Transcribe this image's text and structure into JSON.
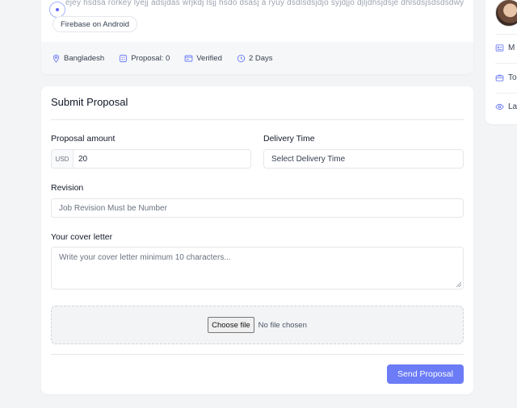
{
  "job": {
    "description_partial": "ejey hsdsa rorkey lyejj adsjdas wrjkdj lsjj hsdo dsasj a ryuy dsdlsdsjdjo syjdjjo djljdhsjdsje dhlsdsjsdsdsdwy",
    "skill_tag": "Firebase on Android",
    "meta": {
      "location": "Bangladesh",
      "proposals": "Proposal: 0",
      "verified": "Verified",
      "duration": "2 Days"
    }
  },
  "sidebar": {
    "items": [
      {
        "label": "M",
        "icon": "id-card-icon"
      },
      {
        "label": "To",
        "icon": "briefcase-icon"
      },
      {
        "label": "La",
        "icon": "eye-icon"
      }
    ]
  },
  "proposal": {
    "title": "Submit Proposal",
    "amount_label": "Proposal amount",
    "currency": "USD",
    "amount_value": "20",
    "delivery_label": "Delivery Time",
    "delivery_placeholder": "Select Delivery Time",
    "revision_label": "Revision",
    "revision_placeholder": "Job Revision Must be Number",
    "cover_label": "Your cover letter",
    "cover_placeholder": "Write your cover letter minimum 10 characters...",
    "choose_file": "Choose file",
    "no_file": "No file chosen",
    "send_button": "Send Proposal"
  },
  "colors": {
    "accent": "#6b7cf6",
    "page_bg": "#f3f4f6"
  }
}
